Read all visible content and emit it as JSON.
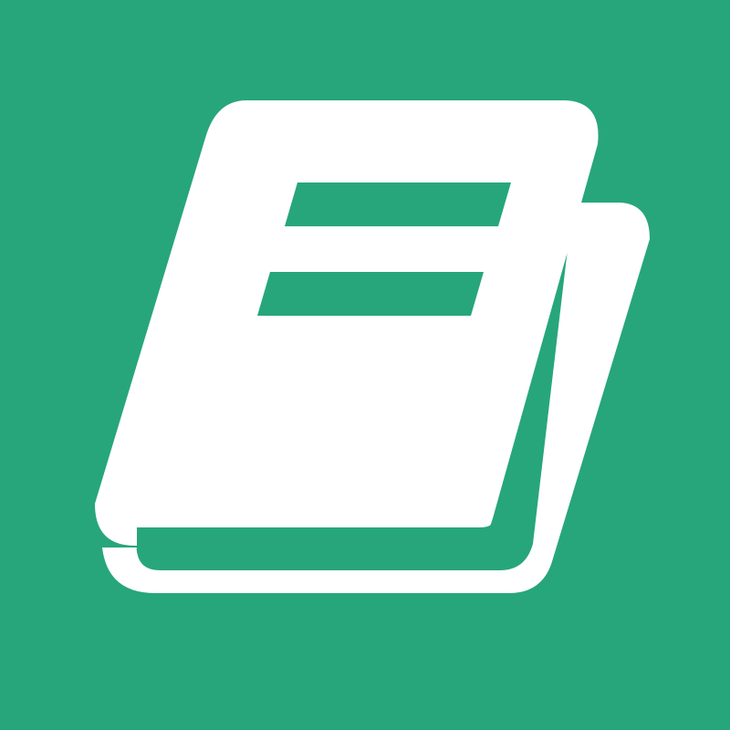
{
  "icon": {
    "name": "book-icon",
    "colors": {
      "background": "#27a67b",
      "glyph": "#ffffff"
    }
  }
}
